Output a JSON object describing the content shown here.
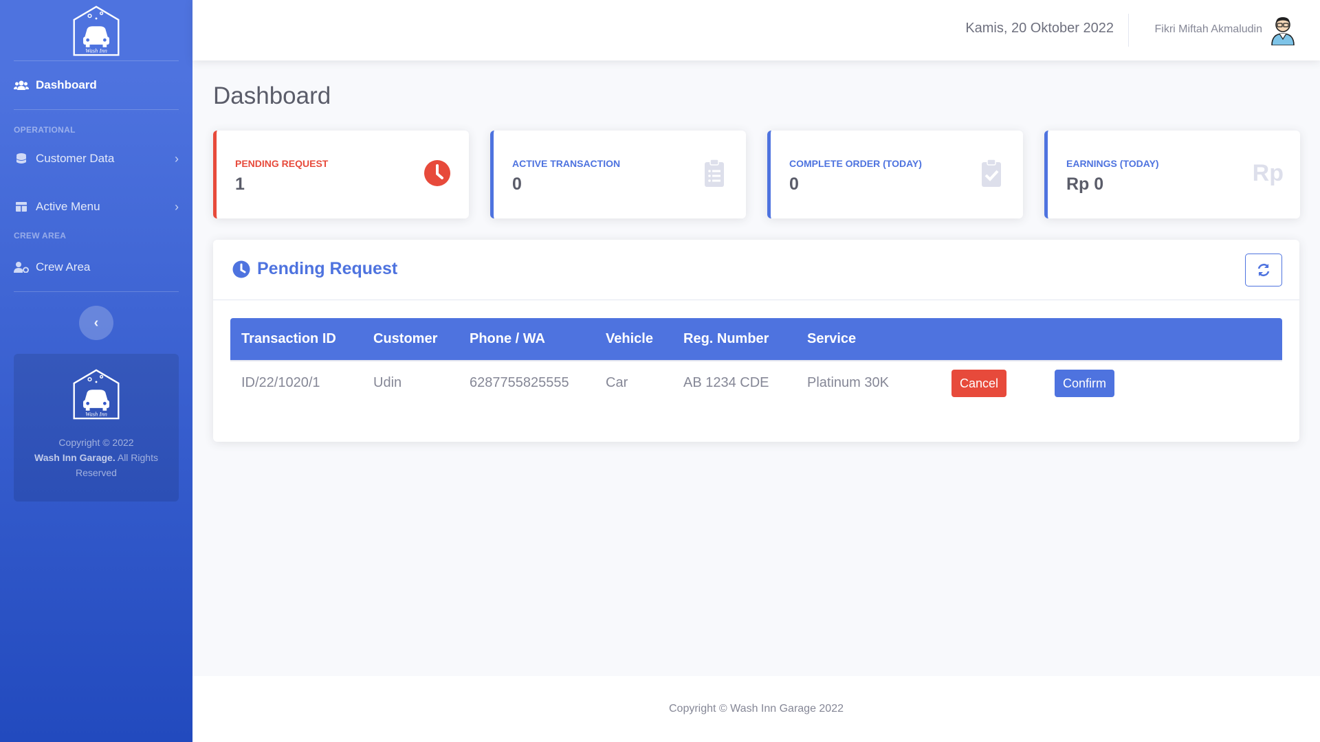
{
  "sidebar": {
    "logo_text": "Wash Inn",
    "items": [
      {
        "label": "Dashboard"
      },
      {
        "label": "Customer Data"
      },
      {
        "label": "Active Menu"
      },
      {
        "label": "Crew Area"
      }
    ],
    "headings": [
      "Operational",
      "Crew Area"
    ],
    "card": {
      "copyright": "Copyright © 2022",
      "company": "Wash Inn Garage.",
      "rights": " All Rights Reserved"
    }
  },
  "topbar": {
    "date": "Kamis, 20 Oktober 2022",
    "user_name": "Fikri Miftah Akmaludin"
  },
  "page": {
    "title": "Dashboard"
  },
  "stats": [
    {
      "label": "Pending Request",
      "value": "1",
      "icon": "clock-icon",
      "color": "#e74a3b"
    },
    {
      "label": "Active Transaction",
      "value": "0",
      "icon": "clipboard-list-icon",
      "color": "#4e73df"
    },
    {
      "label": "Complete Order (Today)",
      "value": "0",
      "icon": "clipboard-check-icon",
      "color": "#4e73df"
    },
    {
      "label": "Earnings (Today)",
      "value": "Rp 0",
      "icon_text": "Rp",
      "color": "#4e73df"
    }
  ],
  "pending": {
    "title": "Pending Request",
    "columns": [
      "Transaction ID",
      "Customer",
      "Phone / WA",
      "Vehicle",
      "Reg. Number",
      "Service"
    ],
    "rows": [
      {
        "id": "ID/22/1020/1",
        "customer": "Udin",
        "phone": "6287755825555",
        "vehicle": "Car",
        "reg": "AB 1234 CDE",
        "service": "Platinum 30K"
      }
    ],
    "cancel_label": "Cancel",
    "confirm_label": "Confirm"
  },
  "footer": {
    "text": "Copyright © Wash Inn Garage 2022"
  },
  "colors": {
    "primary": "#4e73df",
    "danger": "#e74a3b"
  }
}
